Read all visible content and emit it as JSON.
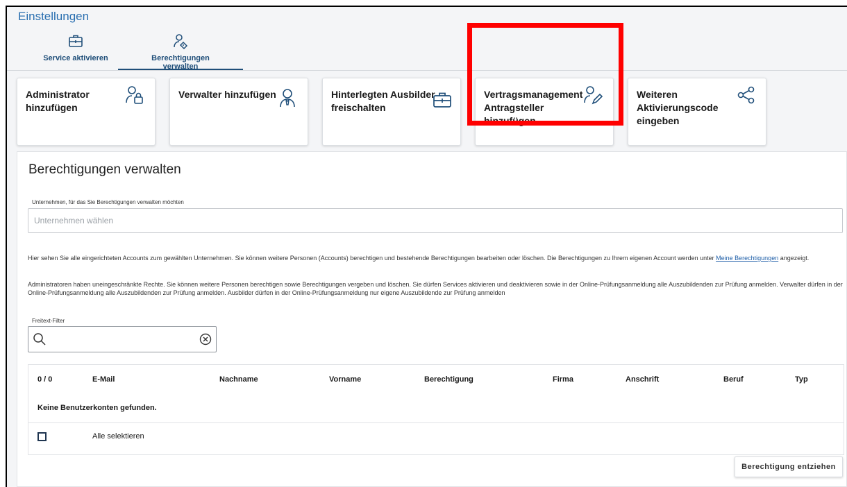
{
  "header": {
    "title": "Einstellungen"
  },
  "tabs": [
    {
      "label": "Service aktivieren",
      "icon": "briefcase-icon"
    },
    {
      "label": "Berechtigungen verwalten",
      "icon": "user-tag-icon",
      "active": true
    }
  ],
  "cards": [
    {
      "label": "Administrator\nhinzufügen",
      "icon": "user-lock-icon"
    },
    {
      "label": "Verwalter hinzufügen",
      "icon": "user-tie-icon"
    },
    {
      "label": "Hinterlegten Ausbilder\nfreischalten",
      "icon": "briefcase-icon"
    },
    {
      "label": "Vertragsmanagement\nAntragsteller\nhinzufügen",
      "icon": "user-edit-icon"
    },
    {
      "label": "Weiteren\nAktivierungscode\neingeben",
      "icon": "share-icon"
    }
  ],
  "highlight_color": "#ff0000",
  "accent_color": "#1f4e79",
  "main": {
    "heading": "Berechtigungen verwalten",
    "company_label": "Unternehmen, für das Sie Berechtigungen verwalten möchten",
    "company_placeholder": "Unternehmen wählen",
    "info1_before": "Hier sehen Sie alle eingerichteten Accounts zum gewählten Unternehmen. Sie können weitere Personen (Accounts) berechtigen und bestehende Berechtigungen bearbeiten oder löschen. Die Berechtigungen zu Ihrem eigenen Account werden unter ",
    "info1_link": "Meine Berechtigungen",
    "info1_after": " angezeigt.",
    "info2": "Administratoren haben uneingeschränkte Rechte. Sie können weitere Personen berechtigen sowie Berechtigungen vergeben und löschen. Sie dürfen Services aktivieren und deaktivieren sowie in der Online-Prüfungsanmeldung alle Auszubildenden zur Prüfung anmelden. Verwalter dürfen in der Online-Prüfungsanmeldung alle Auszubildenden zur Prüfung anmelden. Ausbilder dürfen in der Online-Prüfungsanmeldung nur eigene Auszubildende zur Prüfung anmelden",
    "filter_label": "Freitext-Filter"
  },
  "table": {
    "count": "0 / 0",
    "columns": [
      "E-Mail",
      "Nachname",
      "Vorname",
      "Berechtigung",
      "Firma",
      "Anschrift",
      "Beruf",
      "Typ"
    ],
    "empty_text": "Keine Benutzerkonten gefunden.",
    "select_all": "Alle selektieren"
  },
  "actions": {
    "revoke": "Berechtigung entziehen"
  }
}
